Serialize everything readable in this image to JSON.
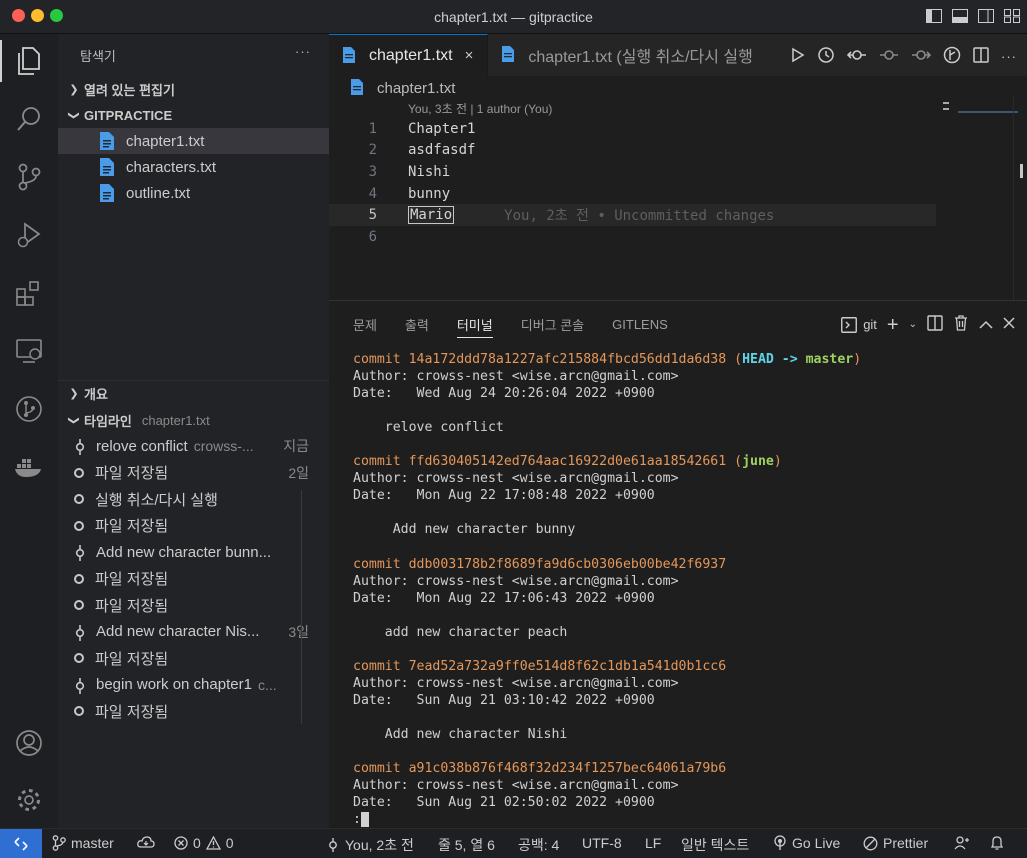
{
  "window": {
    "title": "chapter1.txt — gitpractice"
  },
  "sidebar": {
    "header": "탐색기",
    "more": "···",
    "open_editors": "열려 있는 편집기",
    "project": "GITPRACTICE",
    "files": [
      "chapter1.txt",
      "characters.txt",
      "outline.txt"
    ],
    "outline": "개요",
    "timeline_title": "타임라인",
    "timeline_file": "chapter1.txt"
  },
  "timeline": [
    {
      "label": "relove conflict",
      "desc": "crowss-...",
      "age": "지금",
      "kind": "commit"
    },
    {
      "label": "파일 저장됨",
      "desc": "",
      "age": "2일",
      "kind": "save"
    },
    {
      "label": "실행 취소/다시 실행",
      "desc": "",
      "age": "",
      "kind": "save"
    },
    {
      "label": "파일 저장됨",
      "desc": "",
      "age": "",
      "kind": "save"
    },
    {
      "label": " Add new character bunn...",
      "desc": "",
      "age": "",
      "kind": "commit"
    },
    {
      "label": "파일 저장됨",
      "desc": "",
      "age": "",
      "kind": "save"
    },
    {
      "label": "파일 저장됨",
      "desc": "",
      "age": "",
      "kind": "save"
    },
    {
      "label": "Add new character Nis...",
      "desc": "",
      "age": "3일",
      "kind": "commit"
    },
    {
      "label": "파일 저장됨",
      "desc": "",
      "age": "",
      "kind": "save"
    },
    {
      "label": "begin work on chapter1",
      "desc": "c...",
      "age": "",
      "kind": "commit"
    },
    {
      "label": "파일 저장됨",
      "desc": "",
      "age": "",
      "kind": "save"
    }
  ],
  "editor": {
    "tabs": [
      {
        "label": "chapter1.txt",
        "close": "×"
      },
      {
        "label": "chapter1.txt (실행 취소/다시 실행"
      }
    ],
    "breadcrumb": "chapter1.txt",
    "codelens": "You, 3초 전 | 1 author (You)",
    "lines": [
      {
        "n": "1",
        "text": "Chapter1"
      },
      {
        "n": "2",
        "text": "asdfasdf"
      },
      {
        "n": "3",
        "text": "Nishi"
      },
      {
        "n": "4",
        "text": "bunny"
      },
      {
        "n": "5",
        "text": "Mario"
      },
      {
        "n": "6",
        "text": ""
      }
    ],
    "blame": "You, 2초 전 • Uncommitted changes"
  },
  "panel": {
    "tabs": [
      "문제",
      "출력",
      "터미널",
      "디버그 콘솔",
      "GITLENS"
    ],
    "shell": "git",
    "terminal": {
      "commits": [
        {
          "hash": "commit 14a172ddd78a1227afc215884fbcd56dd1da6d38",
          "refs_head": "HEAD -> ",
          "refs_branch": "master",
          "author": "Author: crowss-nest <wise.arcn@gmail.com>",
          "date": "Date:   Wed Aug 24 20:26:04 2022 +0900",
          "message": "    relove conflict"
        },
        {
          "hash": "commit ffd630405142ed764aac16922d0e61aa18542661",
          "refs_head": "",
          "refs_branch": "june",
          "author": "Author: crowss-nest <wise.arcn@gmail.com>",
          "date": "Date:   Mon Aug 22 17:08:48 2022 +0900",
          "message": "     Add new character bunny"
        },
        {
          "hash": "commit ddb003178b2f8689fa9d6cb0306eb00be42f6937",
          "refs_head": "",
          "refs_branch": "",
          "author": "Author: crowss-nest <wise.arcn@gmail.com>",
          "date": "Date:   Mon Aug 22 17:06:43 2022 +0900",
          "message": "    add new character peach"
        },
        {
          "hash": "commit 7ead52a732a9ff0e514d8f62c1db1a541d0b1cc6",
          "refs_head": "",
          "refs_branch": "",
          "author": "Author: crowss-nest <wise.arcn@gmail.com>",
          "date": "Date:   Sun Aug 21 03:10:42 2022 +0900",
          "message": "    Add new character Nishi"
        },
        {
          "hash": "commit a91c038b876f468f32d234f1257bec64061a79b6",
          "refs_head": "",
          "refs_branch": "",
          "author": "Author: crowss-nest <wise.arcn@gmail.com>",
          "date": "Date:   Sun Aug 21 02:50:02 2022 +0900",
          "message": ""
        }
      ],
      "prompt": ":"
    }
  },
  "statusbar": {
    "branch": "master",
    "errors": "0",
    "warnings": "0",
    "blame": "You, 2초 전",
    "position": "줄 5, 열 6",
    "indent": "공백: 4",
    "encoding": "UTF-8",
    "eol": "LF",
    "language": "일반 텍스트",
    "golive": "Go Live",
    "prettier": "Prettier"
  },
  "colors": {
    "accent": "#0078d4",
    "remote": "#2f6fd1",
    "commit": "#e5975a",
    "head": "#5fd4e7",
    "branch": "#9fd15f"
  }
}
